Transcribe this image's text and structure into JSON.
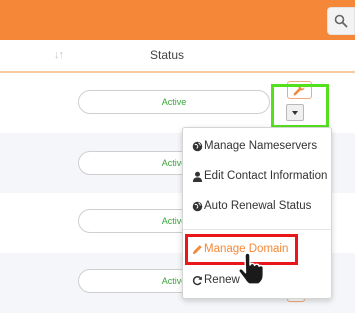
{
  "header": {
    "sort_icon": "sort-arrows-icon",
    "status_label": "Status"
  },
  "rows": [
    {
      "status": "Active"
    },
    {
      "status": "Active"
    },
    {
      "status": "Active"
    },
    {
      "status": "Active"
    }
  ],
  "menu": {
    "items": [
      {
        "label": "Manage Nameservers",
        "icon": "globe-icon"
      },
      {
        "label": "Edit Contact Information",
        "icon": "user-icon"
      },
      {
        "label": "Auto Renewal Status",
        "icon": "globe-icon"
      },
      {
        "label": "Manage Domain",
        "icon": "pencil-icon"
      },
      {
        "label": "Renew",
        "icon": "refresh-icon"
      }
    ]
  },
  "colors": {
    "brand": "#f58838",
    "status_active": "#3aa53a",
    "highlight_green": "#55e01e",
    "highlight_red": "#e8181a"
  }
}
